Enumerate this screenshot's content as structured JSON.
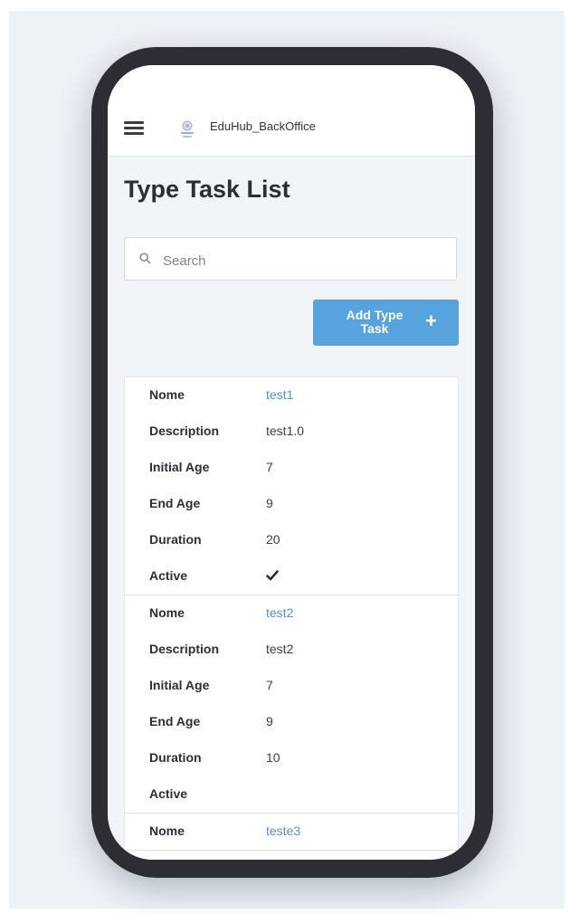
{
  "app": {
    "name": "EduHub_BackOffice"
  },
  "page": {
    "title": "Type Task List"
  },
  "search": {
    "placeholder": "Search",
    "value": ""
  },
  "actions": {
    "add_label": "Add Type Task",
    "add_icon": "plus-icon"
  },
  "colors": {
    "accent": "#57a3dd",
    "link": "#5592c9",
    "frame": "#2c2e33",
    "background": "#f2f5f8"
  },
  "fields": {
    "name": "Nome",
    "description": "Description",
    "initial_age": "Initial Age",
    "end_age": "End Age",
    "duration": "Duration",
    "active": "Active"
  },
  "records": [
    {
      "name": "test1",
      "description": "test1.0",
      "initial_age": "7",
      "end_age": "9",
      "duration": "20",
      "active": true
    },
    {
      "name": "test2",
      "description": "test2",
      "initial_age": "7",
      "end_age": "9",
      "duration": "10",
      "active": false
    },
    {
      "name": "teste3"
    }
  ]
}
